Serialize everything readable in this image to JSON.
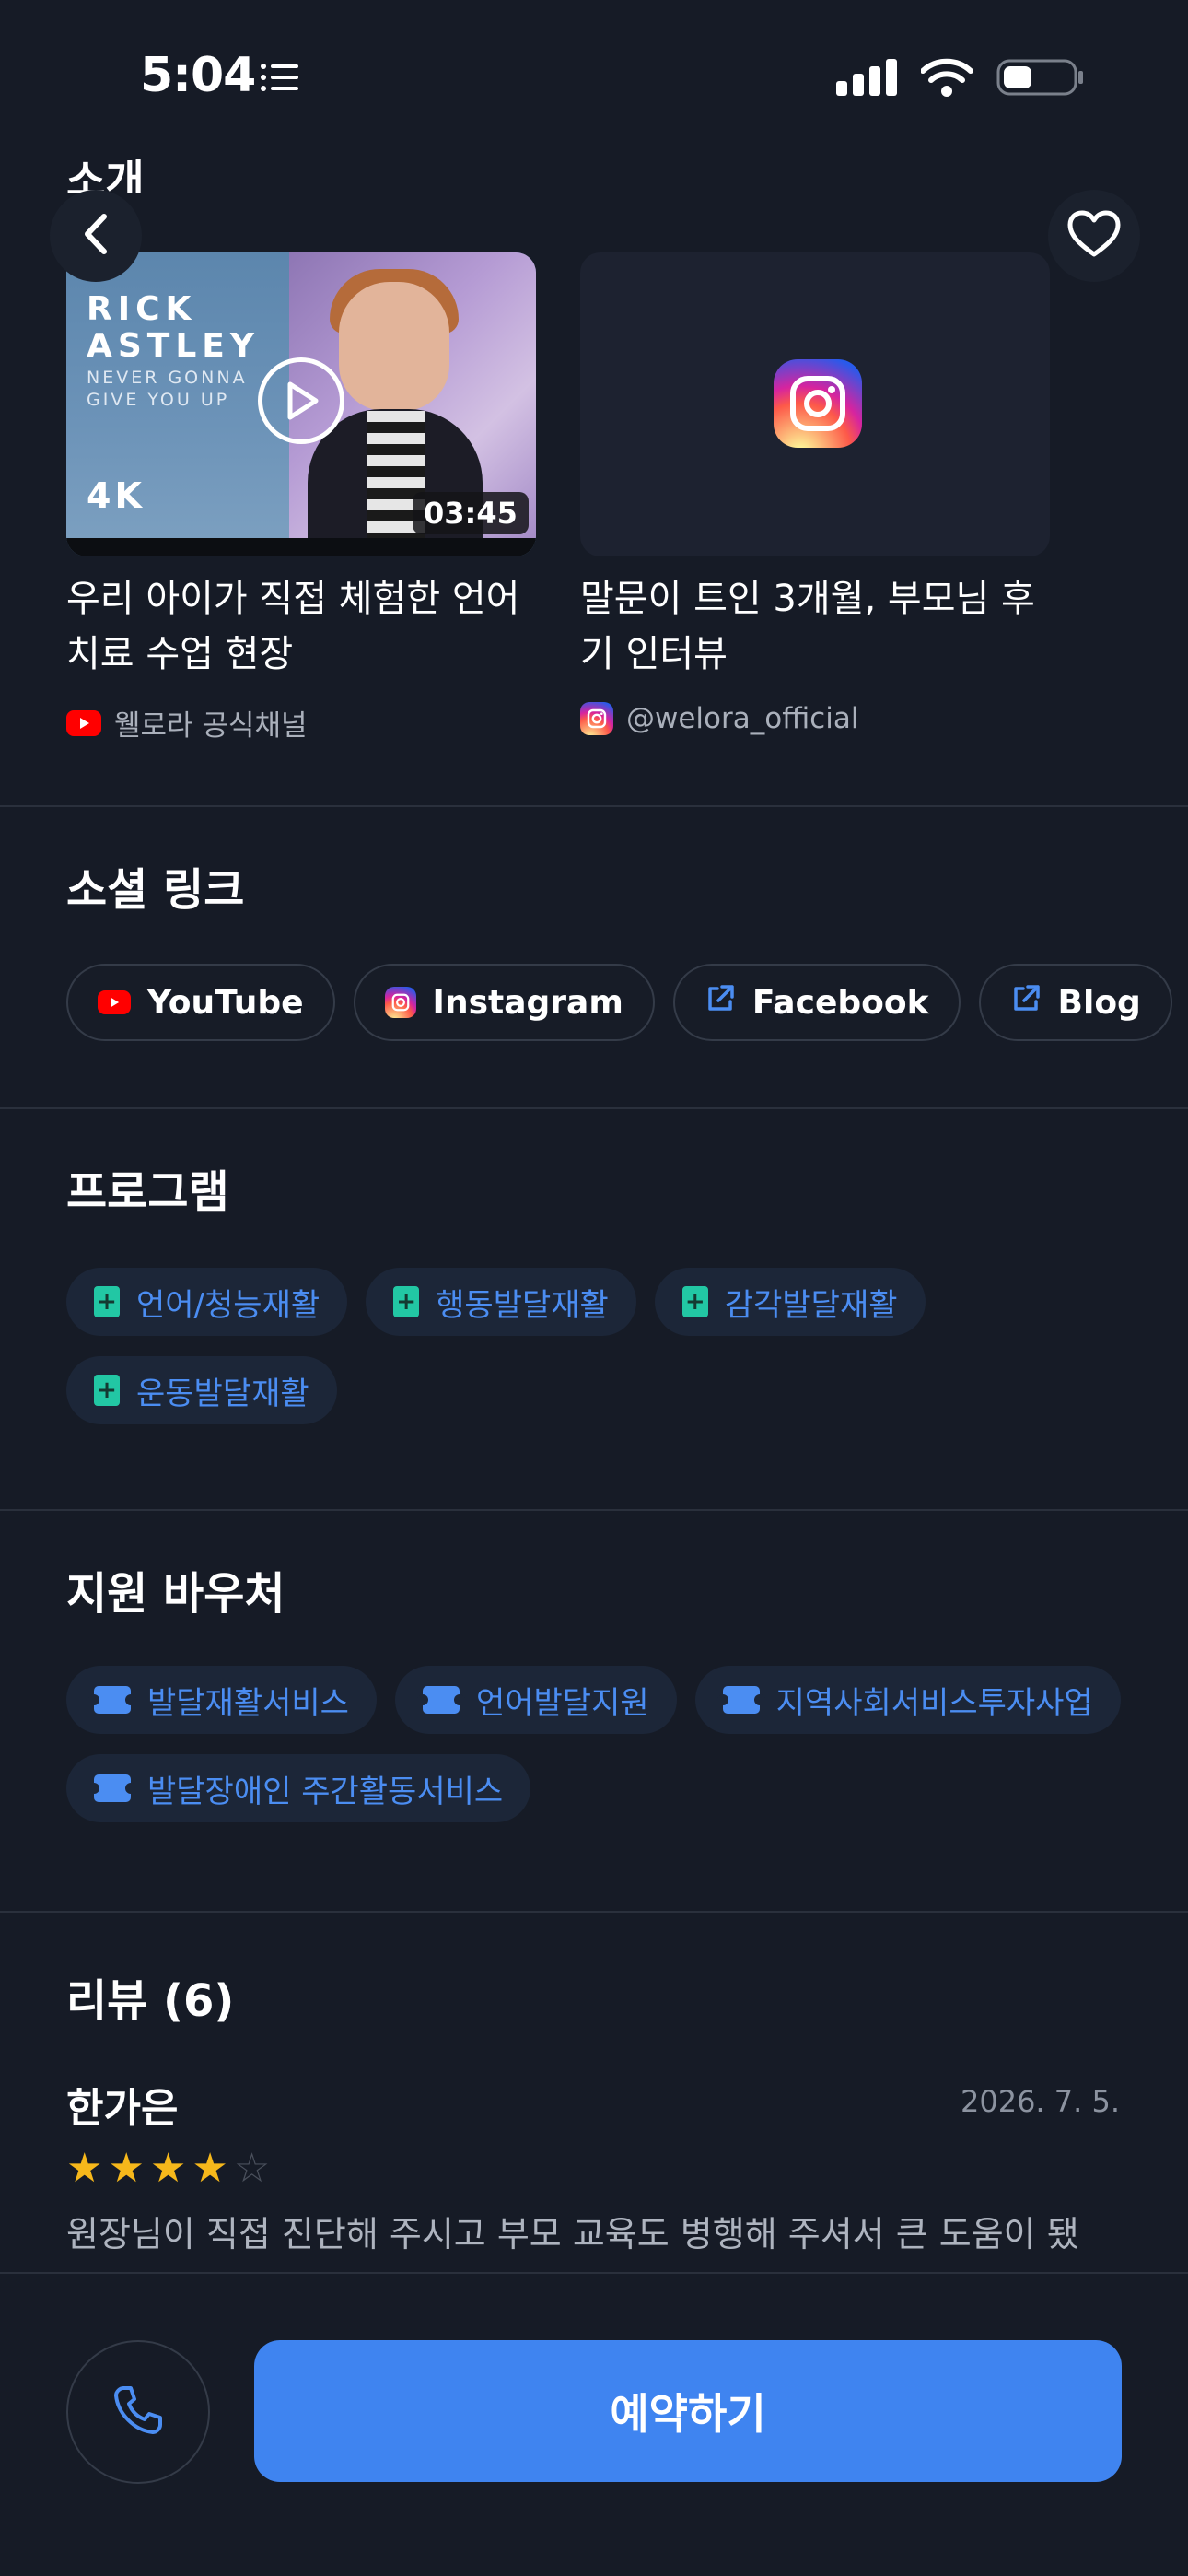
{
  "status_bar": {
    "time": "5:04"
  },
  "intro": {
    "title": "소개"
  },
  "media": [
    {
      "thumb_title": "RICK ASTLEY",
      "thumb_subtitle": "NEVER GONNA GIVE YOU UP",
      "thumb_quality": "4K",
      "duration": "03:45",
      "title": "우리 아이가 직접 체험한 언어 치료 수업 현장",
      "source": "웰로라 공식채널",
      "source_icon": "youtube-icon"
    },
    {
      "title": "말문이 트인 3개월, 부모님 후기 인터뷰",
      "source": "@welora_official",
      "source_icon": "instagram-icon"
    }
  ],
  "social": {
    "title": "소셜 링크",
    "links": [
      {
        "label": "YouTube",
        "icon": "youtube-icon"
      },
      {
        "label": "Instagram",
        "icon": "instagram-icon"
      },
      {
        "label": "Facebook",
        "icon": "external-link-icon"
      },
      {
        "label": "Blog",
        "icon": "external-link-icon"
      }
    ]
  },
  "programs": {
    "title": "프로그램",
    "items": [
      "언어/청능재활",
      "행동발달재활",
      "감각발달재활",
      "운동발달재활"
    ]
  },
  "vouchers": {
    "title": "지원 바우처",
    "items": [
      "발달재활서비스",
      "언어발달지원",
      "지역사회서비스투자사업",
      "발달장애인 주간활동서비스"
    ]
  },
  "reviews": {
    "title": "리뷰 (6)",
    "first": {
      "name": "한가은",
      "date": "2026. 7. 5.",
      "rating": 4,
      "max_rating": 5,
      "text": "원장님이 직접 진단해 주시고 부모 교육도 병행해 주셔서 큰 도움이 됐"
    }
  },
  "actions": {
    "reserve_label": "예약하기"
  },
  "colors": {
    "background": "#161b26",
    "accent": "#3f84f0",
    "tag_text": "#4b8df2",
    "star": "#f6b81b",
    "program_icon": "#22c7a4"
  }
}
